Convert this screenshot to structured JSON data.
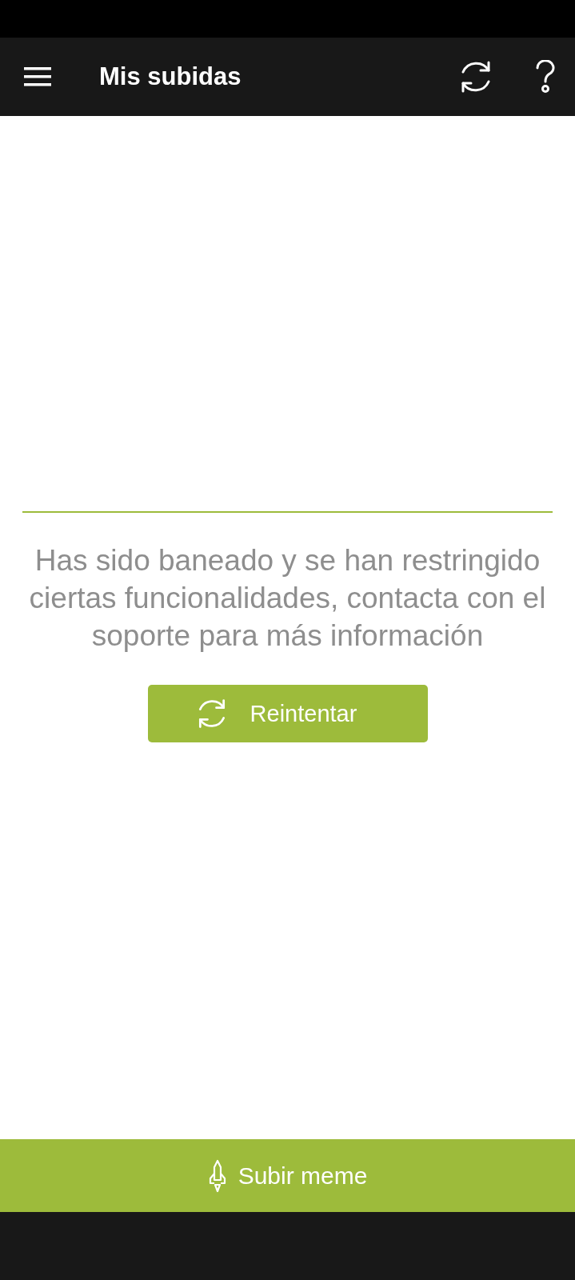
{
  "app_bar": {
    "title": "Mis subidas"
  },
  "message": "Has sido baneado y se han restringido ciertas funcionalidades, contacta con el soporte para más información",
  "retry_button": {
    "label": "Reintentar"
  },
  "upload_button": {
    "label": "Subir meme"
  }
}
